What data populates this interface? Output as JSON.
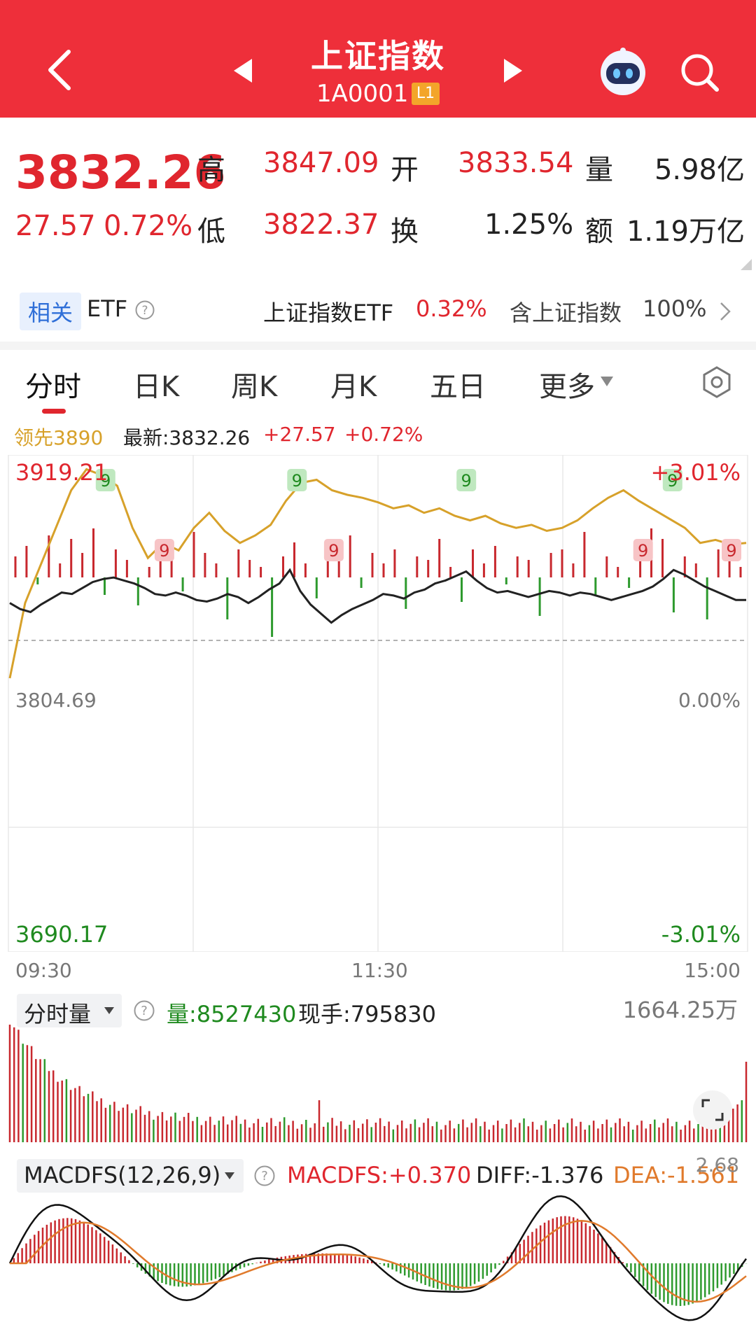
{
  "header": {
    "title": "上证指数",
    "code": "1A0001",
    "level": "L1",
    "bg_color": "#ee2f3a"
  },
  "quote": {
    "price": "3832.26",
    "change": "27.57",
    "change_pct": "0.72%",
    "high_label": "高",
    "high": "3847.09",
    "low_label": "低",
    "low": "3822.37",
    "open_label": "开",
    "open": "3833.54",
    "turnover_label": "换",
    "turnover": "1.25%",
    "volume_label": "量",
    "volume": "5.98亿",
    "amount_label": "额",
    "amount": "1.19万亿",
    "up_color": "#e0262e",
    "down_color": "#1f8a1f"
  },
  "etf": {
    "tag": "相关",
    "label": "ETF",
    "name": "上证指数ETF",
    "change": "0.32%",
    "holding_label": "含上证指数",
    "holding_pct": "100%"
  },
  "tabs": [
    "分时",
    "日K",
    "周K",
    "月K",
    "五日",
    "更多"
  ],
  "active_tab": 0,
  "chart_header": {
    "lead": "领先3890",
    "latest": "最新:3832.26",
    "change": "+27.57",
    "change_pct": "+0.72%"
  },
  "chart_data": {
    "type": "line",
    "y_max_label": "3919.21",
    "y_max_pct": "+3.01%",
    "y_mid_label": "3804.69",
    "y_mid_pct": "0.00%",
    "y_min_label": "3690.17",
    "y_min_pct": "-3.01%",
    "x_labels": [
      "09:30",
      "11:30",
      "15:00"
    ],
    "ylim": [
      3690.17,
      3919.21
    ],
    "prev_close": 3804.69,
    "series": [
      {
        "name": "",
        "color": "#222222",
        "values": [
          3830,
          3826,
          3824,
          3829,
          3833,
          3837,
          3836,
          3840,
          3844,
          3846,
          3847,
          3845,
          3843,
          3840,
          3836,
          3835,
          3837,
          3835,
          3832,
          3831,
          3833,
          3836,
          3834,
          3830,
          3834,
          3839,
          3843,
          3852,
          3838,
          3829,
          3823,
          3817,
          3822,
          3826,
          3829,
          3832,
          3836,
          3835,
          3833,
          3837,
          3839,
          3843,
          3845,
          3848,
          3851,
          3845,
          3840,
          3837,
          3838,
          3836,
          3834,
          3836,
          3838,
          3837,
          3835,
          3837,
          3836,
          3834,
          3832,
          3834,
          3836,
          3838,
          3841,
          3846,
          3852,
          3849,
          3845,
          3841,
          3838,
          3835,
          3832,
          3832
        ]
      },
      {
        "name": "领先",
        "color": "#d7a12a",
        "values": [
          3780,
          3830,
          3855,
          3880,
          3905,
          3919,
          3915,
          3908,
          3880,
          3860,
          3870,
          3865,
          3880,
          3890,
          3878,
          3870,
          3875,
          3882,
          3898,
          3910,
          3912,
          3905,
          3902,
          3900,
          3897,
          3893,
          3895,
          3890,
          3893,
          3888,
          3885,
          3888,
          3883,
          3880,
          3882,
          3878,
          3880,
          3885,
          3893,
          3900,
          3905,
          3898,
          3892,
          3886,
          3880,
          3870,
          3872,
          3869,
          3870
        ]
      }
    ],
    "bars": [
      30,
      45,
      -10,
      60,
      20,
      55,
      35,
      70,
      -25,
      40,
      25,
      -40,
      15,
      50,
      30,
      -20,
      65,
      35,
      20,
      -60,
      40,
      25,
      15,
      -85,
      30,
      50,
      20,
      -30,
      45,
      25,
      60,
      -15,
      35,
      20,
      40,
      -45,
      30,
      25,
      55,
      15,
      -35,
      40,
      20,
      45,
      -10,
      30,
      25,
      -55,
      35,
      40,
      20,
      65,
      -25,
      30,
      15,
      -15,
      45,
      70,
      55,
      -50,
      30,
      20,
      -60,
      40,
      25,
      15
    ]
  },
  "signals": [
    {
      "label": "9",
      "type": "up"
    },
    {
      "label": "9",
      "type": "up"
    },
    {
      "label": "9",
      "type": "up"
    },
    {
      "label": "9",
      "type": "up"
    },
    {
      "label": "9",
      "type": "down"
    },
    {
      "label": "9",
      "type": "down"
    },
    {
      "label": "9",
      "type": "down"
    },
    {
      "label": "9",
      "type": "down"
    }
  ],
  "volume_panel": {
    "selector": "分时量",
    "vol_label": "量:8527430",
    "hand_label": "现手:795830",
    "max_label": "1664.25万"
  },
  "macd_panel": {
    "selector": "MACDFS(12,26,9)",
    "macdfs": "MACDFS:+0.370",
    "diff": "DIFF:-1.376",
    "dea": "DEA:-1.561",
    "corner": "2.68"
  },
  "icons": {
    "back": "back-arrow-icon",
    "prev": "triangle-left-icon",
    "next": "triangle-right-icon",
    "bot": "robot-avatar-icon",
    "search": "search-icon",
    "help": "question-circle-icon",
    "settings": "hexagon-settings-icon",
    "expand": "expand-corners-icon"
  }
}
